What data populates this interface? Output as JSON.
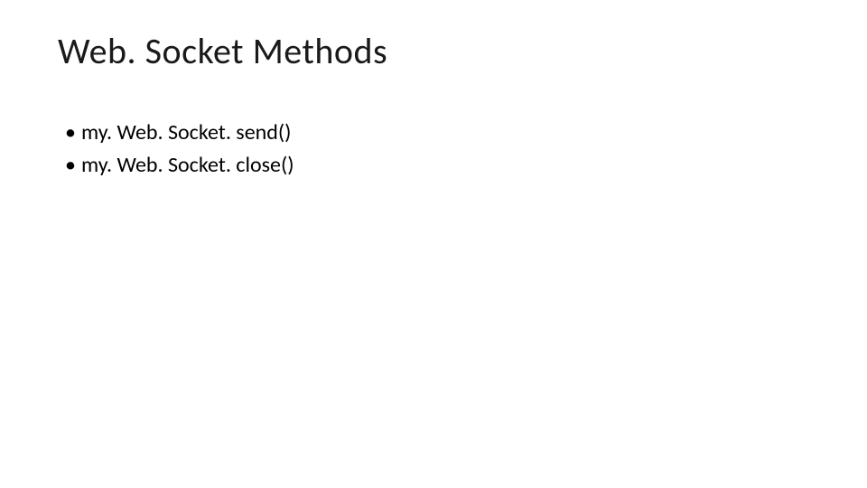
{
  "slide": {
    "title": "Web. Socket Methods",
    "bullets": [
      "my. Web. Socket. send()",
      "my. Web. Socket. close()"
    ]
  }
}
